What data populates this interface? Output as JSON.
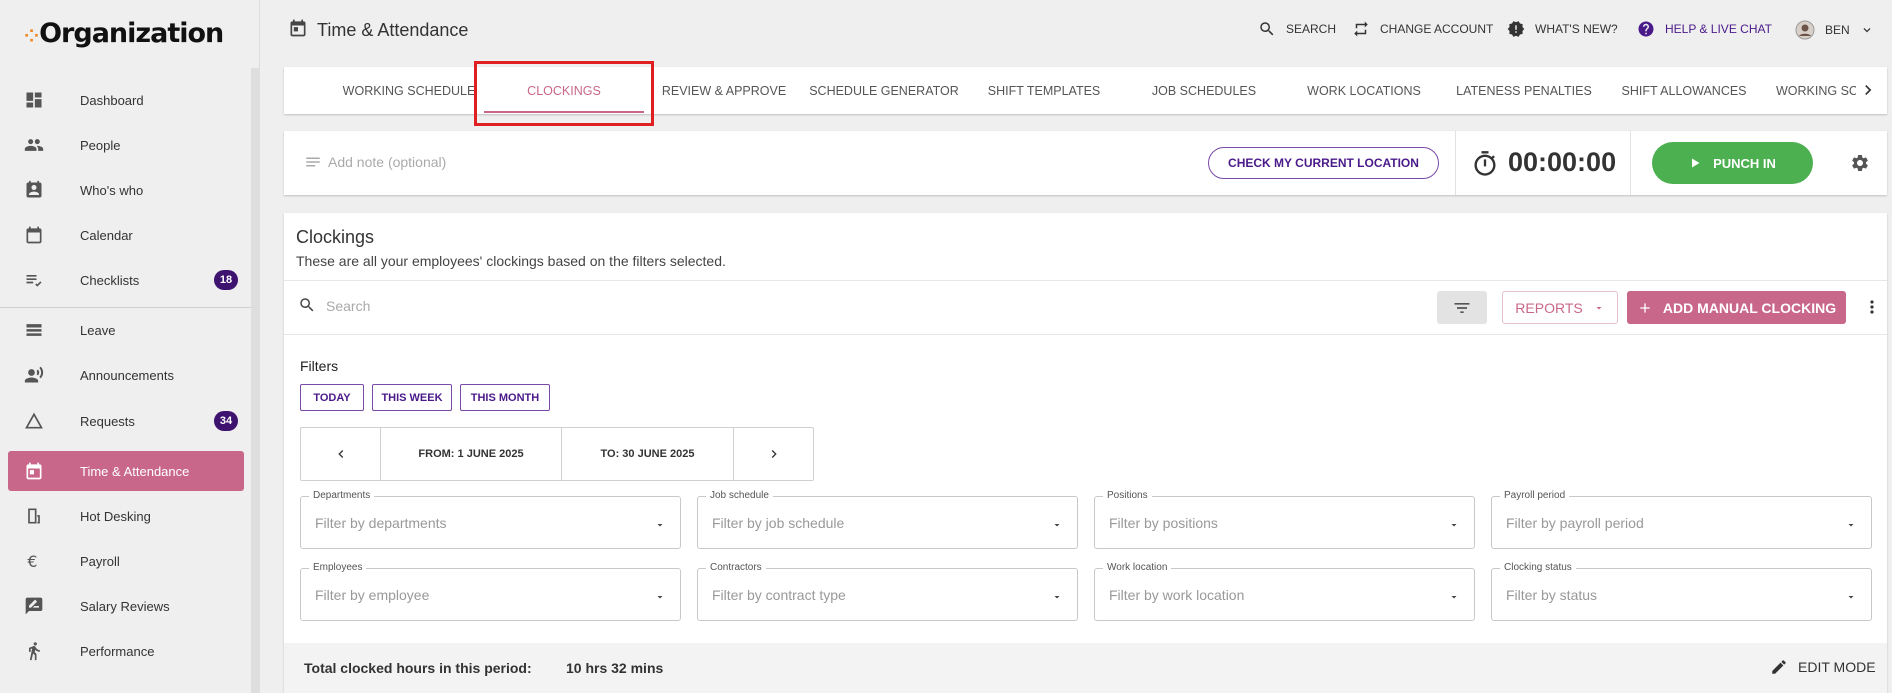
{
  "sidebar": {
    "logo_text": "Organization",
    "items": [
      {
        "label": "Dashboard",
        "icon": "dashboard-icon"
      },
      {
        "label": "People",
        "icon": "people-icon"
      },
      {
        "label": "Who's who",
        "icon": "contact-card-icon"
      },
      {
        "label": "Calendar",
        "icon": "calendar-icon"
      },
      {
        "label": "Checklists",
        "icon": "checklist-icon",
        "badge": "18"
      },
      {
        "label": "Leave",
        "icon": "leave-icon"
      },
      {
        "label": "Announcements",
        "icon": "announcement-icon"
      },
      {
        "label": "Requests",
        "icon": "requests-icon",
        "badge": "34"
      },
      {
        "label": "Time & Attendance",
        "icon": "time-attendance-icon",
        "active": true
      },
      {
        "label": "Hot Desking",
        "icon": "hot-desk-icon"
      },
      {
        "label": "Payroll",
        "icon": "euro-icon"
      },
      {
        "label": "Salary Reviews",
        "icon": "salary-review-icon"
      },
      {
        "label": "Performance",
        "icon": "performance-icon"
      }
    ]
  },
  "header": {
    "title": "Time & Attendance",
    "actions": {
      "search": "Search",
      "change_account": "Change account",
      "whats_new": "What's new?",
      "help": "Help & live chat",
      "user": "BEN"
    }
  },
  "tabs": [
    "Working Schedule",
    "Clockings",
    "Review & Approve",
    "Schedule Generator",
    "Shift Templates",
    "Job Schedules",
    "Work Locations",
    "Lateness Penalties",
    "Shift Allowances",
    "Working Sc"
  ],
  "active_tab": "Clockings",
  "punch": {
    "note_placeholder": "Add note (optional)",
    "check_location": "Check my current location",
    "timer": "00:00:00",
    "punch_in": "Punch in"
  },
  "clockings": {
    "title": "Clockings",
    "subtitle": "These are all your employees' clockings based on the filters selected.",
    "search_placeholder": "Search",
    "reports": "Reports",
    "add_manual": "Add manual clocking",
    "filters_label": "Filters",
    "quick": [
      "Today",
      "This week",
      "This month"
    ],
    "from": "From: 1 June 2025",
    "to": "To: 30 June 2025",
    "fields": [
      {
        "label": "Departments",
        "placeholder": "Filter by departments"
      },
      {
        "label": "Job schedule",
        "placeholder": "Filter by job schedule"
      },
      {
        "label": "Positions",
        "placeholder": "Filter by positions"
      },
      {
        "label": "Payroll period",
        "placeholder": "Filter by payroll period"
      },
      {
        "label": "Employees",
        "placeholder": "Filter by employee"
      },
      {
        "label": "Contractors",
        "placeholder": "Filter by contract type"
      },
      {
        "label": "Work location",
        "placeholder": "Filter by work location"
      },
      {
        "label": "Clocking status",
        "placeholder": "Filter by status"
      }
    ],
    "total_label": "Total clocked hours in this period:",
    "total_value": "10 hrs 32 mins",
    "edit_mode": "Edit mode"
  },
  "colors": {
    "accent": "#c9678a",
    "purple": "#4a1a8a",
    "badge": "#3e1370",
    "green": "#4caf50",
    "highlight": "#e02020"
  }
}
